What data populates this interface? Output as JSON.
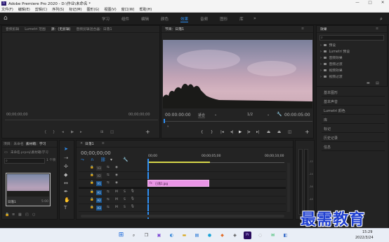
{
  "window": {
    "title": "Adobe Premiere Pro 2020 - D:\\作业\\未命名 *",
    "logo_text": "Pr",
    "minimize": "—",
    "maximize": "□",
    "close": "✕"
  },
  "menu": [
    "文件(F)",
    "编辑(E)",
    "剪辑(C)",
    "序列(S)",
    "标记(M)",
    "图形(G)",
    "视图(V)",
    "窗口(W)",
    "帮助(H)"
  ],
  "workspace_tabs": [
    {
      "label": "学习",
      "active": false
    },
    {
      "label": "组件",
      "active": false
    },
    {
      "label": "编辑",
      "active": false
    },
    {
      "label": "颜色",
      "active": false
    },
    {
      "label": "效果",
      "active": true
    },
    {
      "label": "音频",
      "active": false
    },
    {
      "label": "图形",
      "active": false
    },
    {
      "label": "库",
      "active": false
    }
  ],
  "workspace_more": "»",
  "source_panel": {
    "tabs": [
      "音频剪辑",
      "Lumetri 范围",
      "源：(无剪辑)",
      "音频剪辑混合器：日落1"
    ],
    "timecode_left": "00;00;00;00",
    "timecode_right": "00;00;00;00"
  },
  "program_panel": {
    "title": "节目：日落1",
    "timecode_current": "00:00:00:00",
    "fit": "适合",
    "resolution": "1/2",
    "timecode_total": "00:00:05:00"
  },
  "effects_panel": {
    "title": "效果",
    "items": [
      "预设",
      "Lumetri 预设",
      "音频效果",
      "音频过渡",
      "视频效果",
      "视频过渡"
    ]
  },
  "right_panels": [
    "基本图形",
    "基本声音",
    "Lumetri 颜色",
    "库",
    "标记",
    "历史记录",
    "信息"
  ],
  "project_panel": {
    "tabs": [
      "项目：未命名",
      "素材箱：学习"
    ],
    "breadcrumb": "未命名.prproj\\素材箱\\学习",
    "item_count": "1 个项",
    "clip_name": "日落1",
    "clip_duration": "5:00"
  },
  "timeline": {
    "tab": "日落1",
    "timecode": "00;00;00;00",
    "ruler": [
      "00;00",
      "00;00;05;00",
      "00;00;10;00"
    ],
    "video_tracks": [
      "V3",
      "V2",
      "V1"
    ],
    "audio_tracks": [
      "A1",
      "A2",
      "A3"
    ],
    "clip_label": "日落1.jpg",
    "audio_meter_labels": [
      "-12",
      "-24",
      "-36",
      "-48",
      "dB"
    ]
  },
  "clock": {
    "time": "15:29",
    "date": "2022/3/24"
  },
  "watermark": "最需教育",
  "colors": {
    "accent": "#2b8cf0",
    "clip": "#e995e5",
    "taskbar": "#e9eef6",
    "watermark": "#1f3fcf"
  }
}
